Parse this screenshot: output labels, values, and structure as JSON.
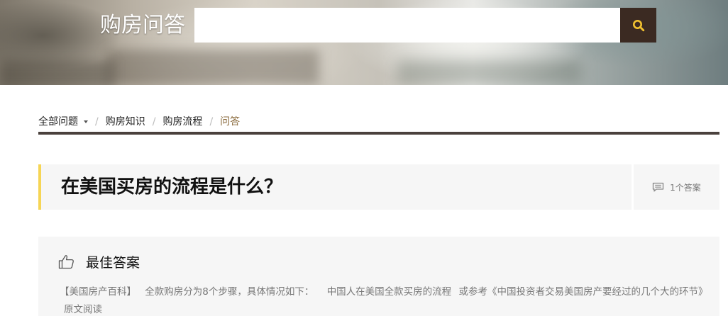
{
  "header": {
    "title": "购房问答",
    "search": {
      "value": "",
      "placeholder": ""
    },
    "search_button_icon": "search-icon",
    "accent_color": "#3b2a22",
    "icon_color": "#f2c230"
  },
  "breadcrumb": {
    "items": [
      {
        "label": "全部问题",
        "has_dropdown": true
      },
      {
        "label": "购房知识"
      },
      {
        "label": "购房流程"
      },
      {
        "label": "问答",
        "current": true
      }
    ],
    "separator": "/"
  },
  "question": {
    "title": "在美国买房的流程是什么？",
    "answer_count": "1个答案",
    "answer_count_icon": "comment-icon",
    "accent_color": "#f6d555"
  },
  "best_answer": {
    "heading": "最佳答案",
    "heading_icon": "thumbs-up-icon",
    "source": "【美国房产百科】",
    "intro": "全款购房分为8个步骤，具体情况如下：",
    "link1": "中国人在美国全款买房的流程",
    "or_text": "或参考",
    "link2": "《中国投资者交易美国房产要经过的几个大的环节》",
    "read_more": "原文阅读"
  }
}
